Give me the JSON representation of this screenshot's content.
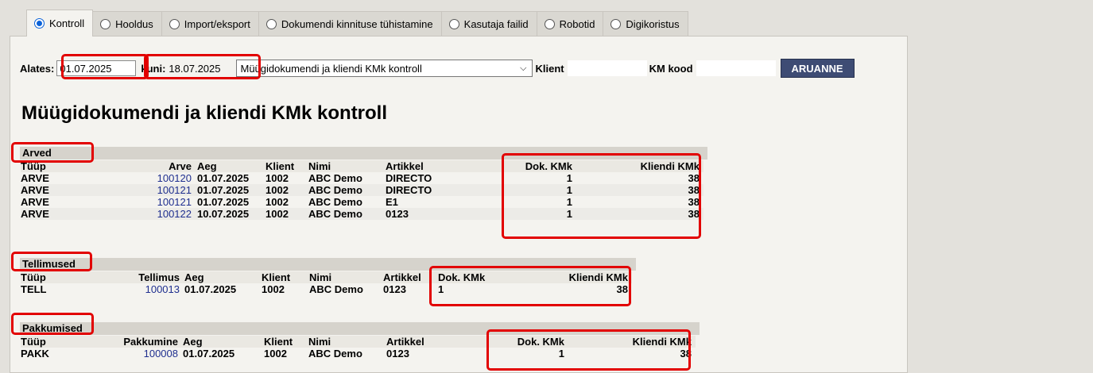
{
  "tabs": [
    {
      "label": "Kontroll",
      "active": true
    },
    {
      "label": "Hooldus",
      "active": false
    },
    {
      "label": "Import/eksport",
      "active": false
    },
    {
      "label": "Dokumendi kinnituse tühistamine",
      "active": false
    },
    {
      "label": "Kasutaja failid",
      "active": false
    },
    {
      "label": "Robotid",
      "active": false
    },
    {
      "label": "Digikoristus",
      "active": false
    }
  ],
  "filter": {
    "from_label": "Alates:",
    "from_value": "01.07.2025",
    "to_label": "kuni:",
    "to_value": "18.07.2025",
    "report_select": "Müügidokumendi ja kliendi KMk kontroll",
    "client_label": "Klient",
    "client_value": "",
    "vat_label": "KM kood",
    "vat_value": "",
    "submit_label": "ARUANNE"
  },
  "page_title": "Müügidokumendi ja kliendi KMk kontroll",
  "arved": {
    "title": "Arved",
    "headers": {
      "type": "Tüüp",
      "doc": "Arve",
      "date": "Aeg",
      "client": "Klient",
      "name": "Nimi",
      "item": "Artikkel",
      "dok": "Dok. KMk",
      "kliendi": "Kliendi KMk"
    },
    "rows": [
      {
        "type": "ARVE",
        "doc": "100120",
        "date": "01.07.2025",
        "client": "1002",
        "name": "ABC Demo",
        "item": "DIRECTO",
        "dok": "1",
        "kliendi": "38"
      },
      {
        "type": "ARVE",
        "doc": "100121",
        "date": "01.07.2025",
        "client": "1002",
        "name": "ABC Demo",
        "item": "DIRECTO",
        "dok": "1",
        "kliendi": "38"
      },
      {
        "type": "ARVE",
        "doc": "100121",
        "date": "01.07.2025",
        "client": "1002",
        "name": "ABC Demo",
        "item": "E1",
        "dok": "1",
        "kliendi": "38"
      },
      {
        "type": "ARVE",
        "doc": "100122",
        "date": "10.07.2025",
        "client": "1002",
        "name": "ABC Demo",
        "item": "0123",
        "dok": "1",
        "kliendi": "38"
      }
    ]
  },
  "tellimused": {
    "title": "Tellimused",
    "headers": {
      "type": "Tüüp",
      "doc": "Tellimus",
      "date": "Aeg",
      "client": "Klient",
      "name": "Nimi",
      "item": "Artikkel",
      "dok": "Dok. KMk",
      "kliendi": "Kliendi KMk"
    },
    "rows": [
      {
        "type": "TELL",
        "doc": "100013",
        "date": "01.07.2025",
        "client": "1002",
        "name": "ABC Demo",
        "item": "0123",
        "dok": "1",
        "kliendi": "38"
      }
    ]
  },
  "pakkumised": {
    "title": "Pakkumised",
    "headers": {
      "type": "Tüüp",
      "doc": "Pakkumine",
      "date": "Aeg",
      "client": "Klient",
      "name": "Nimi",
      "item": "Artikkel",
      "dok": "Dok. KMk",
      "kliendi": "Kliendi KMk"
    },
    "rows": [
      {
        "type": "PAKK",
        "doc": "100008",
        "date": "01.07.2025",
        "client": "1002",
        "name": "ABC Demo",
        "item": "0123",
        "dok": "1",
        "kliendi": "38"
      }
    ]
  },
  "colors": {
    "highlight": "#e20000",
    "link": "#1f2f8f",
    "button": "#3e4c74",
    "radio_selected": "#0b62d8"
  }
}
